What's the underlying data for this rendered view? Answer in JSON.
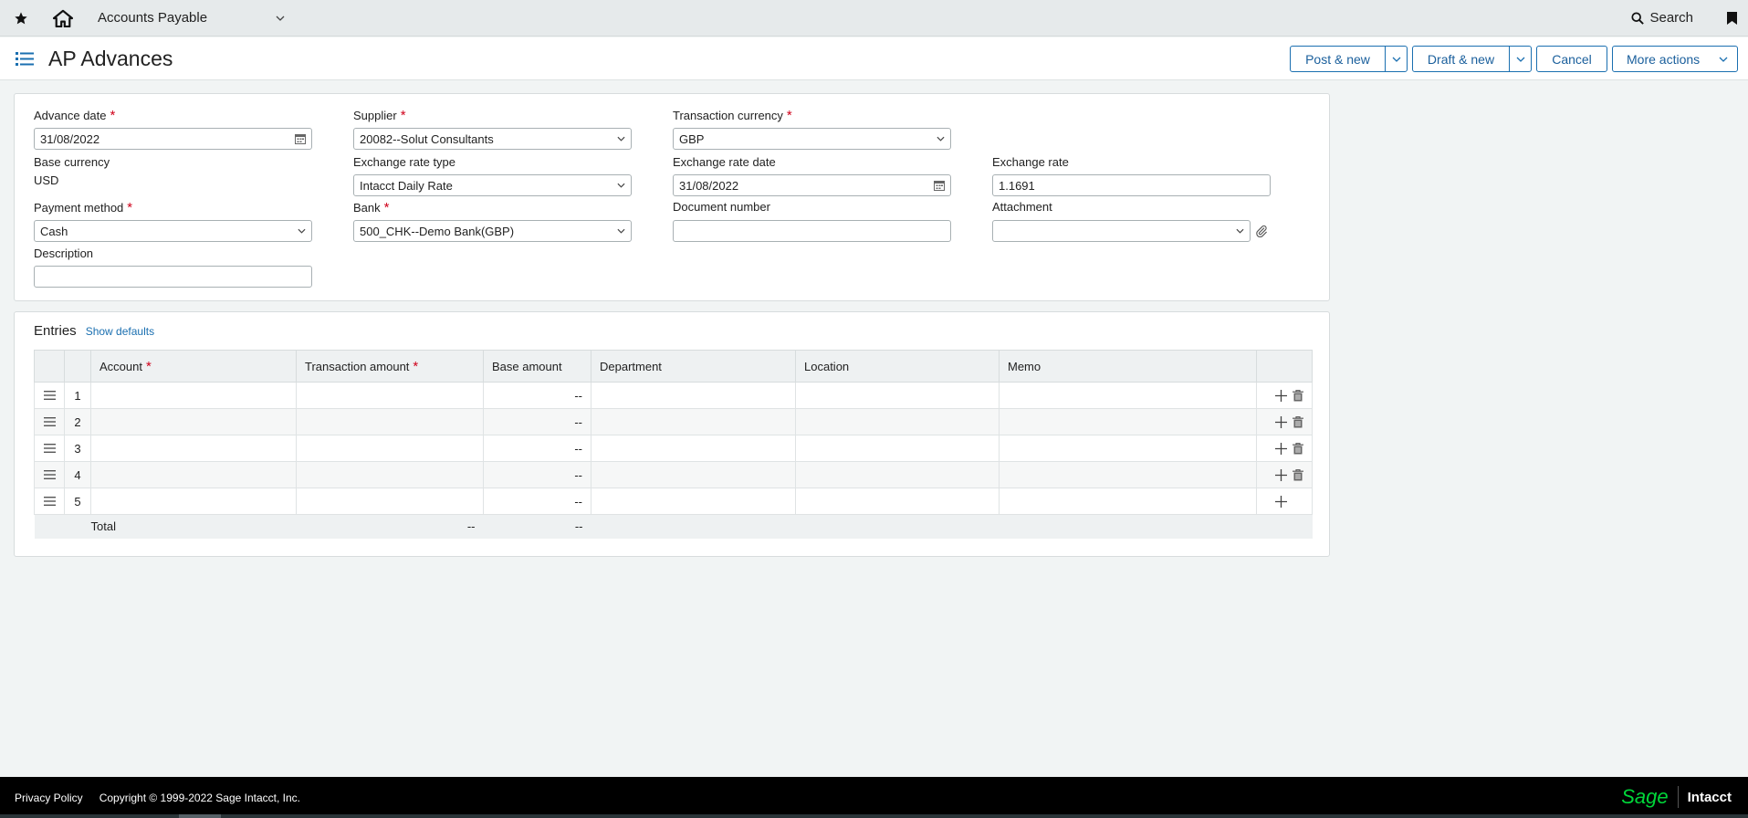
{
  "topbar": {
    "module": "Accounts Payable",
    "search_label": "Search"
  },
  "header": {
    "title": "AP Advances",
    "buttons": {
      "post_new": "Post & new",
      "draft_new": "Draft & new",
      "cancel": "Cancel",
      "more_actions": "More actions"
    }
  },
  "form": {
    "advance_date": {
      "label": "Advance date",
      "value": "31/08/2022"
    },
    "supplier": {
      "label": "Supplier",
      "value": "20082--Solut Consultants"
    },
    "transaction_currency": {
      "label": "Transaction currency",
      "value": "GBP"
    },
    "base_currency": {
      "label": "Base currency",
      "value": "USD"
    },
    "exchange_rate_type": {
      "label": "Exchange rate type",
      "value": "Intacct Daily Rate"
    },
    "exchange_rate_date": {
      "label": "Exchange rate date",
      "value": "31/08/2022"
    },
    "exchange_rate": {
      "label": "Exchange rate",
      "value": "1.1691"
    },
    "payment_method": {
      "label": "Payment method",
      "value": "Cash"
    },
    "bank": {
      "label": "Bank",
      "value": "500_CHK--Demo Bank(GBP)"
    },
    "document_number": {
      "label": "Document number",
      "value": ""
    },
    "attachment": {
      "label": "Attachment",
      "value": ""
    },
    "description": {
      "label": "Description",
      "value": ""
    },
    "required_mark": "*"
  },
  "entries": {
    "title": "Entries",
    "show_defaults": "Show defaults",
    "columns": {
      "account": "Account",
      "transaction_amount": "Transaction amount",
      "base_amount": "Base amount",
      "department": "Department",
      "location": "Location",
      "memo": "Memo"
    },
    "rows": [
      {
        "num": "1",
        "base_amount": "--"
      },
      {
        "num": "2",
        "base_amount": "--"
      },
      {
        "num": "3",
        "base_amount": "--"
      },
      {
        "num": "4",
        "base_amount": "--"
      },
      {
        "num": "5",
        "base_amount": "--"
      }
    ],
    "total": {
      "label": "Total",
      "transaction_amount": "--",
      "base_amount": "--"
    }
  },
  "footer": {
    "privacy": "Privacy Policy",
    "copyright": "Copyright © 1999-2022 Sage Intacct, Inc.",
    "brand_sage": "Sage",
    "brand_intacct": "Intacct"
  },
  "colors": {
    "accent": "#1a6fb0",
    "required": "#d0021b",
    "sage_green": "#00d639"
  }
}
